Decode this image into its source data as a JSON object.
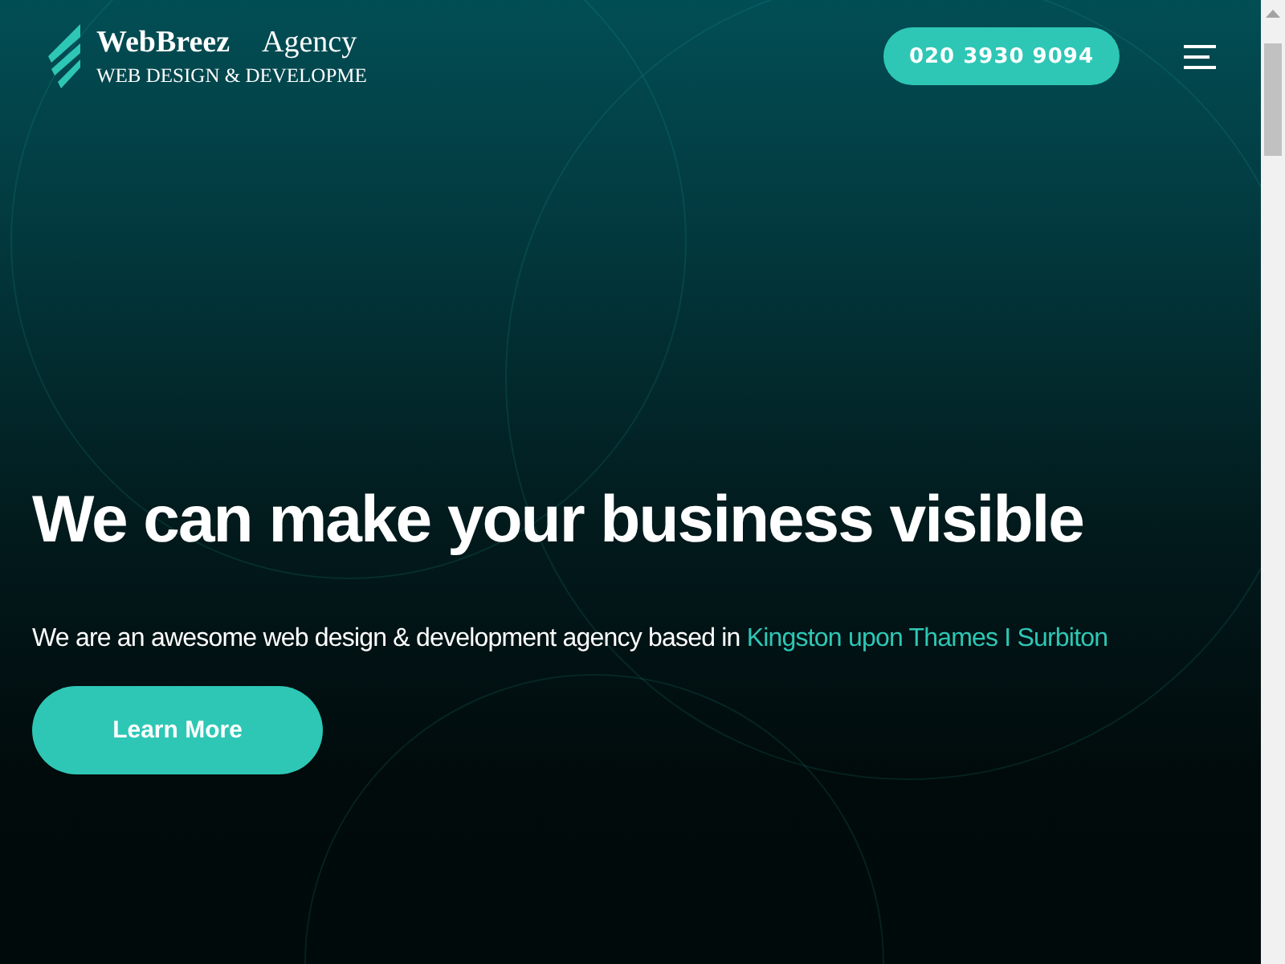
{
  "header": {
    "logo": {
      "name": "WebBreez",
      "suffix": "Agency",
      "tagline": "WEB DESIGN & DEVELOPME"
    },
    "phone": "020 3930 9094"
  },
  "hero": {
    "title": "We can make your business visible",
    "text": "We are an awesome web design & development agency based in",
    "link": "Kingston upon Thames I Surbiton",
    "button": "Learn More"
  }
}
